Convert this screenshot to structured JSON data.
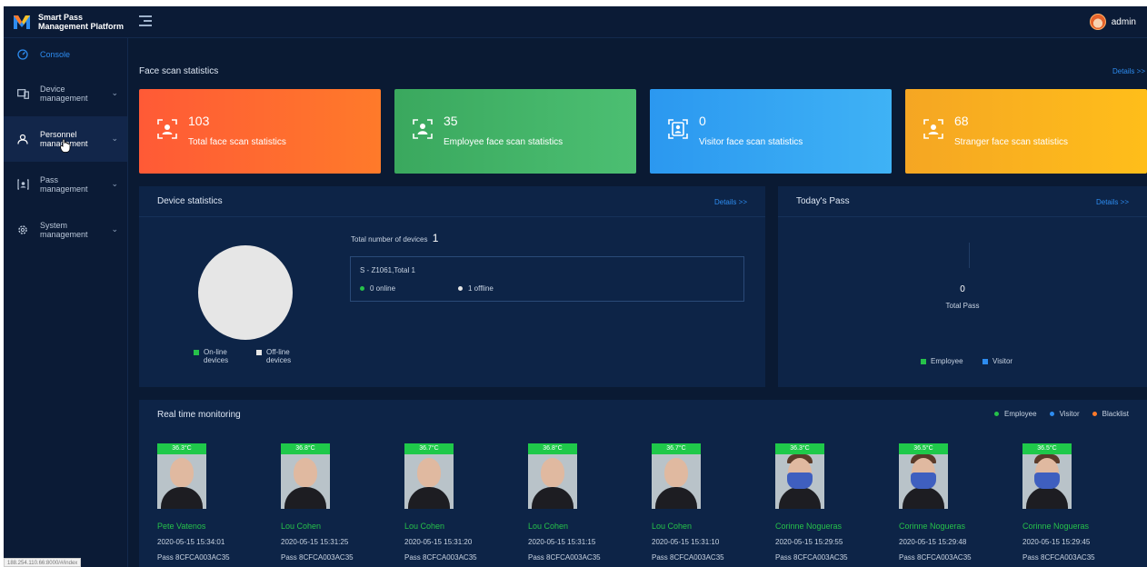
{
  "app": {
    "title_line1": "Smart Pass",
    "title_line2": "Management Platform",
    "user_name": "admin"
  },
  "sidebar": {
    "items": [
      {
        "label": "Console",
        "icon": "dashboard-icon",
        "active": true
      },
      {
        "label": "Device management",
        "icon": "device-icon"
      },
      {
        "label": "Personnel management",
        "icon": "personnel-icon"
      },
      {
        "label": "Pass management",
        "icon": "pass-icon"
      },
      {
        "label": "System management",
        "icon": "gear-icon"
      }
    ]
  },
  "face_scan": {
    "title": "Face scan statistics",
    "details": "Details >>",
    "cards": [
      {
        "value": "103",
        "label": "Total face scan statistics",
        "color_from": "#ff5a36",
        "color_to": "#ff7a2a"
      },
      {
        "value": "35",
        "label": "Employee face scan statistics",
        "color_from": "#3aa85e",
        "color_to": "#4cbf72"
      },
      {
        "value": "0",
        "label": "Visitor face scan statistics",
        "color_from": "#2b98f0",
        "color_to": "#3fb2f5"
      },
      {
        "value": "68",
        "label": "Stranger face scan statistics",
        "color_from": "#f5a623",
        "color_to": "#ffbe1a"
      }
    ]
  },
  "device_stats": {
    "title": "Device statistics",
    "details": "Details >>",
    "legend_online": "On-line devices",
    "legend_offline": "Off-line devices",
    "total_label": "Total number of devices",
    "total_value": "1",
    "device_name": "S - Z1061,Total 1",
    "online_text": "0 online",
    "offline_text": "1 offline",
    "online_color": "#26c14a",
    "offline_color": "#e6e6e6"
  },
  "todays_pass": {
    "title": "Today's Pass",
    "details": "Details >>",
    "total_value": "0",
    "total_label": "Total Pass",
    "legend_employee": "Employee",
    "legend_visitor": "Visitor",
    "employee_color": "#26c14a",
    "visitor_color": "#2d8cf0"
  },
  "realtime": {
    "title": "Real time monitoring",
    "legend": [
      {
        "label": "Employee",
        "color": "#26c14a"
      },
      {
        "label": "Visitor",
        "color": "#2d8cf0"
      },
      {
        "label": "Blacklist",
        "color": "#ff7a2a"
      }
    ],
    "people": [
      {
        "temp": "36.3°C",
        "name": "Pete Vatenos",
        "time": "2020-05-15 15:34:01",
        "pass": "Pass 8CFCA003AC35",
        "mask": false
      },
      {
        "temp": "36.8°C",
        "name": "Lou Cohen",
        "time": "2020-05-15 15:31:25",
        "pass": "Pass 8CFCA003AC35",
        "mask": false
      },
      {
        "temp": "36.7°C",
        "name": "Lou Cohen",
        "time": "2020-05-15 15:31:20",
        "pass": "Pass 8CFCA003AC35",
        "mask": false
      },
      {
        "temp": "36.8°C",
        "name": "Lou Cohen",
        "time": "2020-05-15 15:31:15",
        "pass": "Pass 8CFCA003AC35",
        "mask": false
      },
      {
        "temp": "36.7°C",
        "name": "Lou Cohen",
        "time": "2020-05-15 15:31:10",
        "pass": "Pass 8CFCA003AC35",
        "mask": false
      },
      {
        "temp": "36.3°C",
        "name": "Corinne Nogueras",
        "time": "2020-05-15 15:29:55",
        "pass": "Pass 8CFCA003AC35",
        "mask": true
      },
      {
        "temp": "36.5°C",
        "name": "Corinne Nogueras",
        "time": "2020-05-15 15:29:48",
        "pass": "Pass 8CFCA003AC35",
        "mask": true
      },
      {
        "temp": "36.5°C",
        "name": "Corinne Nogueras",
        "time": "2020-05-15 15:29:45",
        "pass": "Pass 8CFCA003AC35",
        "mask": true
      }
    ]
  },
  "status_url": "188.254.110.66:8000/#/index"
}
